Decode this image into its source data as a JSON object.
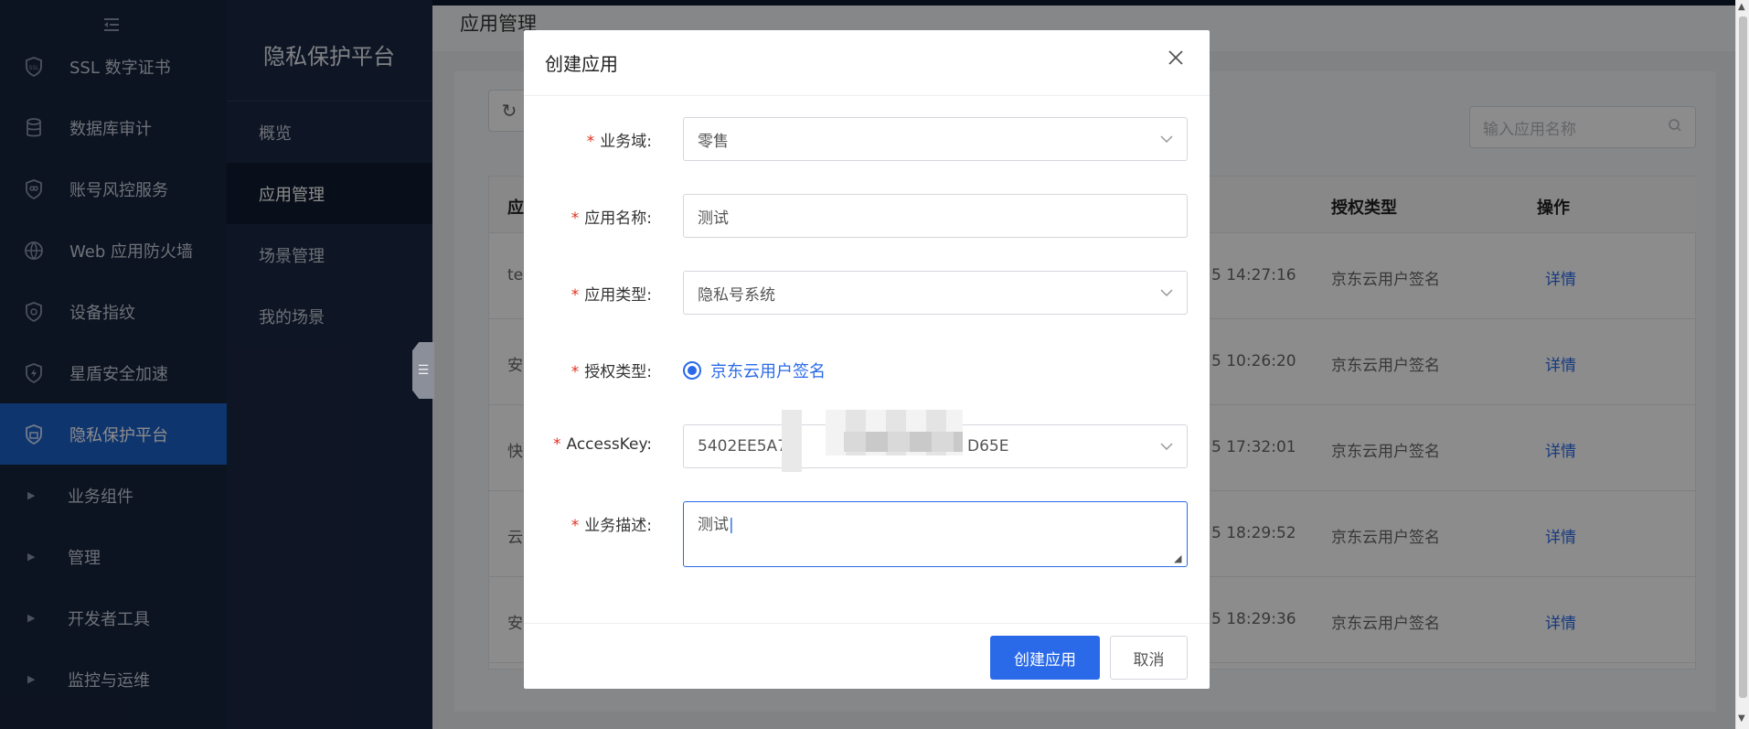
{
  "sidebar": {
    "items": [
      {
        "label": "SSL 数字证书",
        "icon": "ssl-certificate-icon"
      },
      {
        "label": "数据库审计",
        "icon": "database-icon"
      },
      {
        "label": "账号风控服务",
        "icon": "account-shield-icon"
      },
      {
        "label": "Web 应用防火墙",
        "icon": "web-firewall-icon"
      },
      {
        "label": "设备指纹",
        "icon": "fingerprint-shield-icon"
      },
      {
        "label": "星盾安全加速",
        "icon": "lightning-shield-icon"
      },
      {
        "label": "隐私保护平台",
        "icon": "privacy-shield-icon",
        "active": true
      }
    ],
    "groups": [
      "业务组件",
      "管理",
      "开发者工具",
      "监控与运维"
    ]
  },
  "subnav": {
    "title": "隐私保护平台",
    "items": [
      "概览",
      "应用管理",
      "场景管理",
      "我的场景"
    ],
    "active": "应用管理"
  },
  "main": {
    "title": "应用管理",
    "search_placeholder": "输入应用名称",
    "table": {
      "headers": {
        "first": "应",
        "auth": "授权类型",
        "action": "操作"
      },
      "rows": [
        {
          "name": "te",
          "time": "5 14:27:16",
          "auth": "京东云用户签名",
          "action": "详情"
        },
        {
          "name": "安",
          "time": "5 10:26:20",
          "auth": "京东云用户签名",
          "action": "详情"
        },
        {
          "name": "快",
          "time": "5 17:32:01",
          "auth": "京东云用户签名",
          "action": "详情"
        },
        {
          "name": "云",
          "time": "5 18:29:52",
          "auth": "京东云用户签名",
          "action": "详情"
        },
        {
          "name": "安",
          "time": "5 18:29:36",
          "auth": "京东云用户签名",
          "action": "详情"
        }
      ]
    }
  },
  "modal": {
    "title": "创建应用",
    "fields": {
      "domain": {
        "label": "业务域:",
        "value": "零售"
      },
      "name": {
        "label": "应用名称:",
        "value": "测试"
      },
      "type": {
        "label": "应用类型:",
        "value": "隐私号系统"
      },
      "auth": {
        "label": "授权类型:",
        "value": "京东云用户签名"
      },
      "accesskey": {
        "label": "AccessKey:",
        "value_left": "5402EE5A7",
        "value_right": "D65E"
      },
      "desc": {
        "label": "业务描述:",
        "value": "测试"
      }
    },
    "submit": "创建应用",
    "cancel": "取消"
  },
  "colors": {
    "primary": "#2a6ae9",
    "sidebar_bg": "#17233d",
    "required": "#e0301e"
  }
}
